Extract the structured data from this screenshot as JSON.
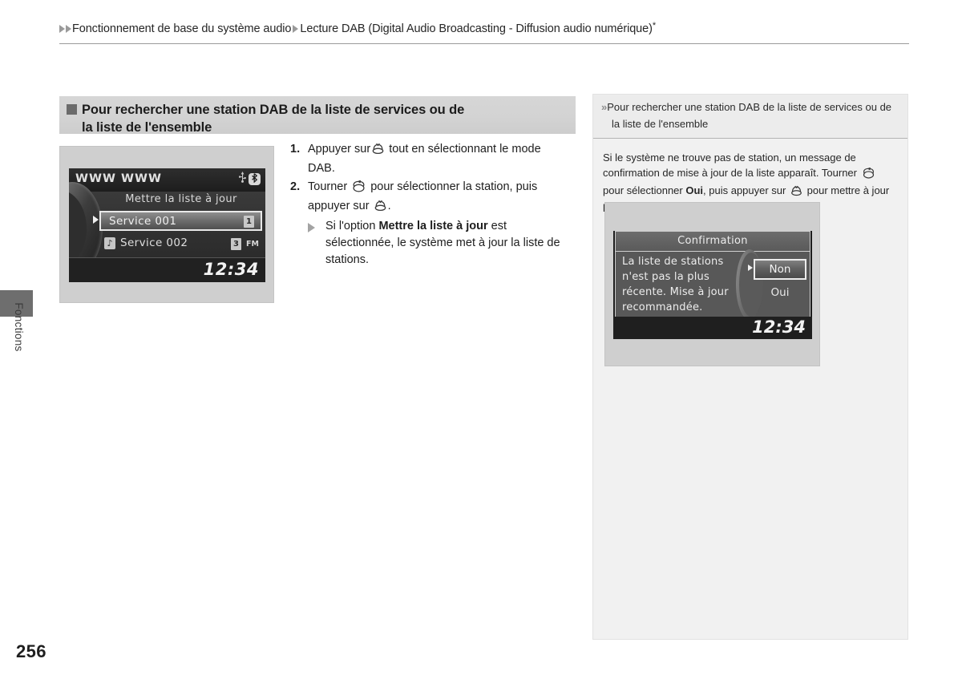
{
  "breadcrumb": {
    "part1": "Fonctionnement de base du système audio",
    "part2": "Lecture DAB (Digital Audio Broadcasting - Diffusion audio numérique)",
    "asterisk": "*"
  },
  "side_tab": {
    "label": "Fonctions"
  },
  "page_number": "256",
  "section": {
    "heading_line1": "Pour rechercher une station DAB de la liste de services ou de",
    "heading_line2": "la liste de l'ensemble"
  },
  "radio_screenshot": {
    "title": "WWW WWW",
    "icons": {
      "usb": "⚲",
      "bluetooth": "✵"
    },
    "list_label": "Mettre la liste à jour",
    "row_selected": {
      "text": "Service 001",
      "badge": "1"
    },
    "row_second": {
      "text": "Service 002",
      "badge": "3",
      "band": "FM",
      "note_icon": "♪"
    },
    "clock": "12:34"
  },
  "steps": [
    {
      "num": "1.",
      "text_before": "Appuyer sur",
      "glyph": "enter-knob-icon",
      "text_after": "tout en sélectionnant le mode DAB."
    },
    {
      "num": "2.",
      "text_before": "Tourner",
      "glyph": "rotary-knob-icon",
      "text_mid": "pour sélectionner la station, puis appuyer sur",
      "glyph2": "enter-knob-icon",
      "text_after": "."
    }
  ],
  "substep": {
    "prefix": "Si l'option",
    "bold": "Mettre la liste à jour",
    "suffix": "est sélectionnée, le système met à jour la liste de stations."
  },
  "sidebar": {
    "header_line1": "Pour rechercher une station DAB de la liste de services ou de",
    "header_line2": "la liste de l'ensemble",
    "body_part1": "Si le système ne trouve pas de station, un message de confirmation de mise à jour de la liste apparaît. Tourner",
    "body_part2": "pour sélectionner",
    "body_bold": "Oui",
    "body_part3": ", puis appuyer sur",
    "body_part4": "pour mettre à jour la liste."
  },
  "dialog_screenshot": {
    "title": "Confirmation",
    "message": "La liste de stations n'est pas la plus récente. Mise à jour recommandée.",
    "button_no": "Non",
    "button_yes": "Oui",
    "clock": "12:34"
  },
  "colors": {
    "heading_bar": "#d3d3d3",
    "marker": "#6b6b6b",
    "sidebar_bg": "#f1f1f1",
    "screen_bg": "#1a1a1a",
    "arrow": "#9a9a9a"
  }
}
